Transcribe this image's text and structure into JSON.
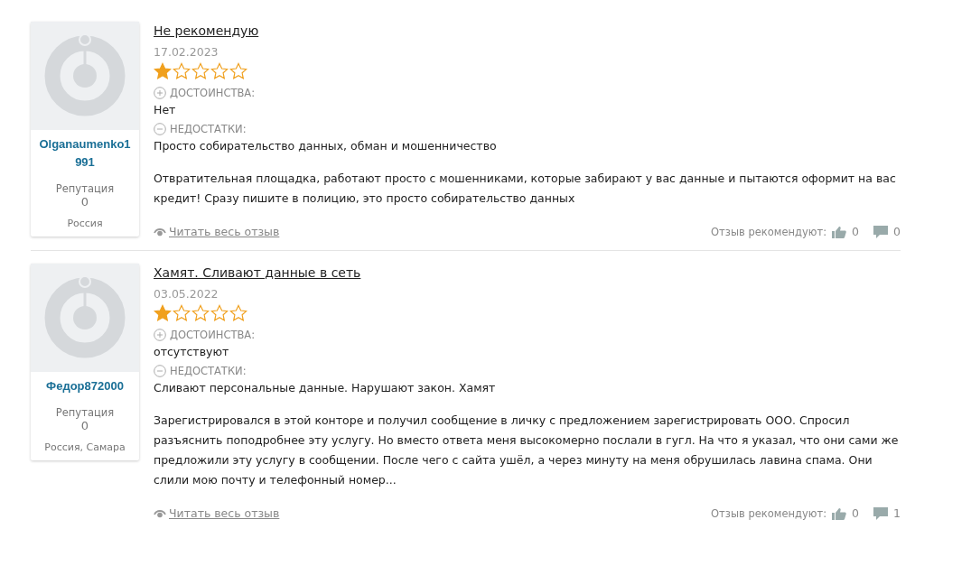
{
  "reviews": [
    {
      "author": "Olganaumenko1991",
      "reputation_label": "Репутация",
      "reputation": "0",
      "location": "Россия",
      "title": "Не рекомендую",
      "date": "17.02.2023",
      "stars": 1,
      "pros_label": "ДОСТОИНСТВА:",
      "pros": "Нет",
      "cons_label": "НЕДОСТАТКИ:",
      "cons": "Просто собирательство данных, обман и мошенничество",
      "text": "Отвратительная площадка, работают просто с мошенниками, которые забирают у вас данные и пытаются оформит на вас кредит! Сразу пишите в полицию, это просто собирательство данных",
      "read_more": "Читать весь отзыв",
      "recommend_label": "Отзыв рекомендуют:",
      "likes": "0",
      "comments": "0"
    },
    {
      "author": "Федор872000",
      "reputation_label": "Репутация",
      "reputation": "0",
      "location": "Россия, Самара",
      "title": "Хамят. Сливают данные в сеть",
      "date": "03.05.2022",
      "stars": 1,
      "pros_label": "ДОСТОИНСТВА:",
      "pros": "отсутствуют",
      "cons_label": "НЕДОСТАТКИ:",
      "cons": "Сливают персональные данные. Нарушают закон. Хамят",
      "text": "Зарегистрировался в этой конторе и получил сообщение в личку с предложением зарегистрировать ООО. Спросил разъяснить поподробнее эту услугу. Но вместо ответа меня высокомерно послали в гугл. На что я указал, что они сами же предложили эту услугу в сообщении. После чего с сайта ушёл, а через минуту на меня обрушилась лавина спама. Они слили мою почту и телефонный номер...",
      "read_more": "Читать весь отзыв",
      "recommend_label": "Отзыв рекомендуют:",
      "likes": "0",
      "comments": "1"
    }
  ]
}
